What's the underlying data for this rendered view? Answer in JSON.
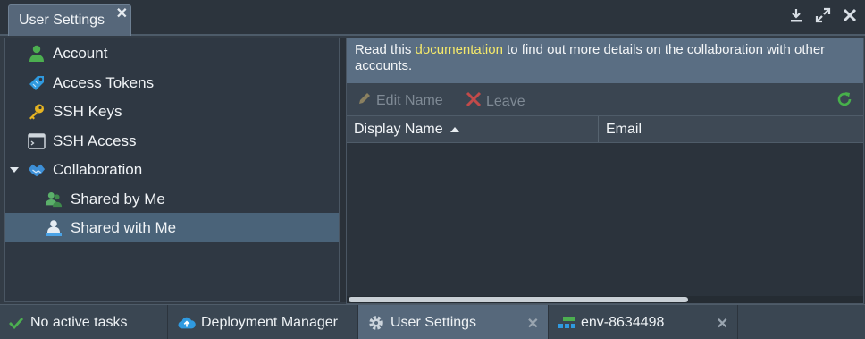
{
  "window": {
    "tab_title": "User Settings",
    "tab_close": "✕",
    "controls": [
      "download-icon",
      "expand-icon",
      "close-icon"
    ]
  },
  "sidebar": {
    "items": [
      {
        "label": "Account",
        "icon": "user-icon",
        "color": "#4caf50"
      },
      {
        "label": "Access Tokens",
        "icon": "tag-icon",
        "color": "#2f9ae0"
      },
      {
        "label": "SSH Keys",
        "icon": "key-icon",
        "color": "#e6b422"
      },
      {
        "label": "SSH Access",
        "icon": "terminal-icon",
        "color": "#cfd6dc"
      },
      {
        "label": "Collaboration",
        "icon": "handshake-icon",
        "color": "#3d8fd6",
        "expanded": true
      },
      {
        "label": "Shared by Me",
        "icon": "users-icon",
        "color": "#5bb06a"
      },
      {
        "label": "Shared with Me",
        "icon": "user-share-icon",
        "color": "#4ba3e6",
        "selected": true
      }
    ]
  },
  "main": {
    "info_prefix": "Read this ",
    "info_link": "documentation",
    "info_suffix": " to find out more details on the collaboration with other accounts.",
    "toolbar": {
      "edit_label": "Edit Name",
      "leave_label": "Leave",
      "refresh_icon": "refresh-icon"
    },
    "columns": [
      {
        "label": "Display Name",
        "sort": "asc"
      },
      {
        "label": "Email"
      }
    ],
    "rows": []
  },
  "taskbar": {
    "items": [
      {
        "label": "No active tasks",
        "icon": "check-icon"
      },
      {
        "label": "Deployment Manager",
        "icon": "cloud-upload-icon"
      },
      {
        "label": "User Settings",
        "icon": "gear-icon",
        "active": true,
        "closable": true
      },
      {
        "label": "env-8634498",
        "icon": "environment-icon",
        "closable": true
      }
    ],
    "close_glyph": "✕"
  },
  "colors": {
    "accent_link": "#f5e96a",
    "selected_row": "#4a6379",
    "info_bar": "#5a6e83",
    "refresh_green": "#47b04b",
    "leave_red": "#d64545"
  }
}
